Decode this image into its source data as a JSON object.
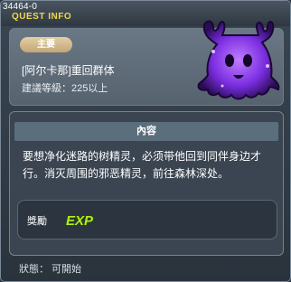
{
  "window": {
    "id": "34464-0",
    "title": "QUEST INFO"
  },
  "quest": {
    "category_badge": "主要",
    "name": "[阿尔卡那]重回群体",
    "level_requirement": "建議等級：225以上"
  },
  "content": {
    "header": "內容",
    "description": "要想净化迷路的树精灵，必须带他回到同伴身边才行。消灭周围的邪恶精灵，前往森林深处。"
  },
  "reward": {
    "label": "獎勵",
    "exp_icon_text": "EXP"
  },
  "status": {
    "text": "狀態： 可開始"
  },
  "colors": {
    "title_yellow": "#f0d84a",
    "badge_beige": "#d6c096",
    "exp_green": "#b4ee1e",
    "npc_purple": "#8a3cf0"
  },
  "icons": {
    "npc": "purple-spirit-npc",
    "reward": "exp-icon"
  }
}
